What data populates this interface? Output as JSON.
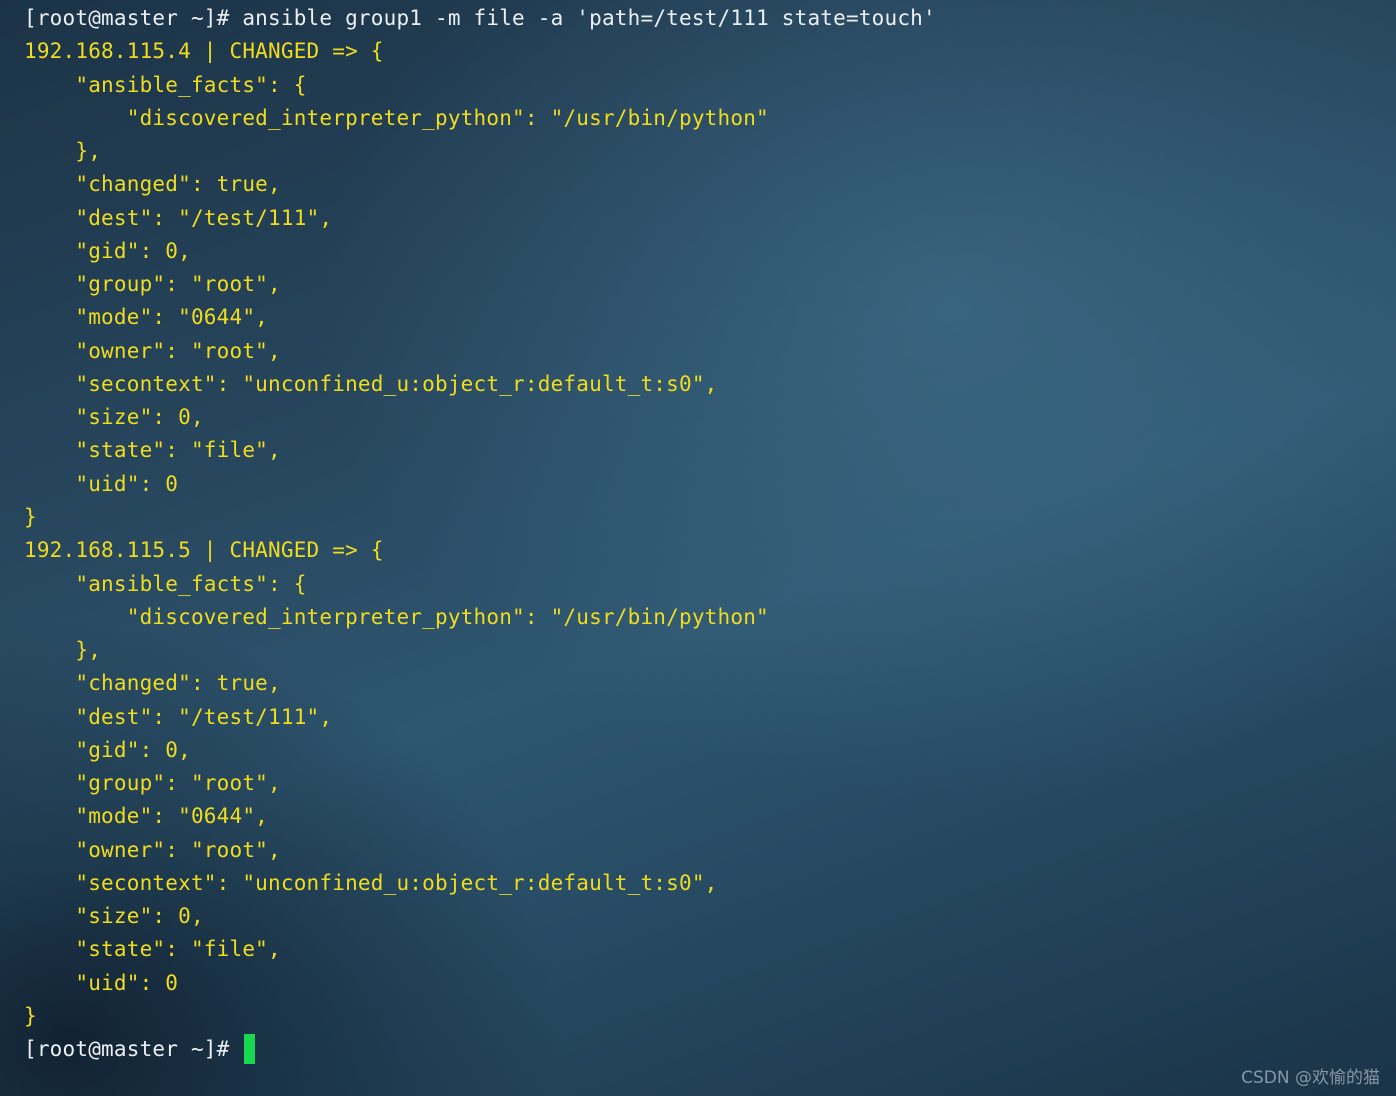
{
  "terminal": {
    "prompt": "[root@master ~]# ",
    "command": "ansible group1 -m file -a 'path=/test/111 state=touch'",
    "output_lines": [
      "192.168.115.4 | CHANGED => {",
      "    \"ansible_facts\": {",
      "        \"discovered_interpreter_python\": \"/usr/bin/python\"",
      "    },",
      "    \"changed\": true,",
      "    \"dest\": \"/test/111\",",
      "    \"gid\": 0,",
      "    \"group\": \"root\",",
      "    \"mode\": \"0644\",",
      "    \"owner\": \"root\",",
      "    \"secontext\": \"unconfined_u:object_r:default_t:s0\",",
      "    \"size\": 0,",
      "    \"state\": \"file\",",
      "    \"uid\": 0",
      "}",
      "192.168.115.5 | CHANGED => {",
      "    \"ansible_facts\": {",
      "        \"discovered_interpreter_python\": \"/usr/bin/python\"",
      "    },",
      "    \"changed\": true,",
      "    \"dest\": \"/test/111\",",
      "    \"gid\": 0,",
      "    \"group\": \"root\",",
      "    \"mode\": \"0644\",",
      "    \"owner\": \"root\",",
      "    \"secontext\": \"unconfined_u:object_r:default_t:s0\",",
      "    \"size\": 0,",
      "    \"state\": \"file\",",
      "    \"uid\": 0",
      "}"
    ],
    "final_prompt": "[root@master ~]# "
  },
  "watermark": "CSDN @欢愉的猫",
  "colors": {
    "prompt_text": "#ecf0f3",
    "output_text": "#f0dc1e",
    "cursor": "#18d850"
  }
}
